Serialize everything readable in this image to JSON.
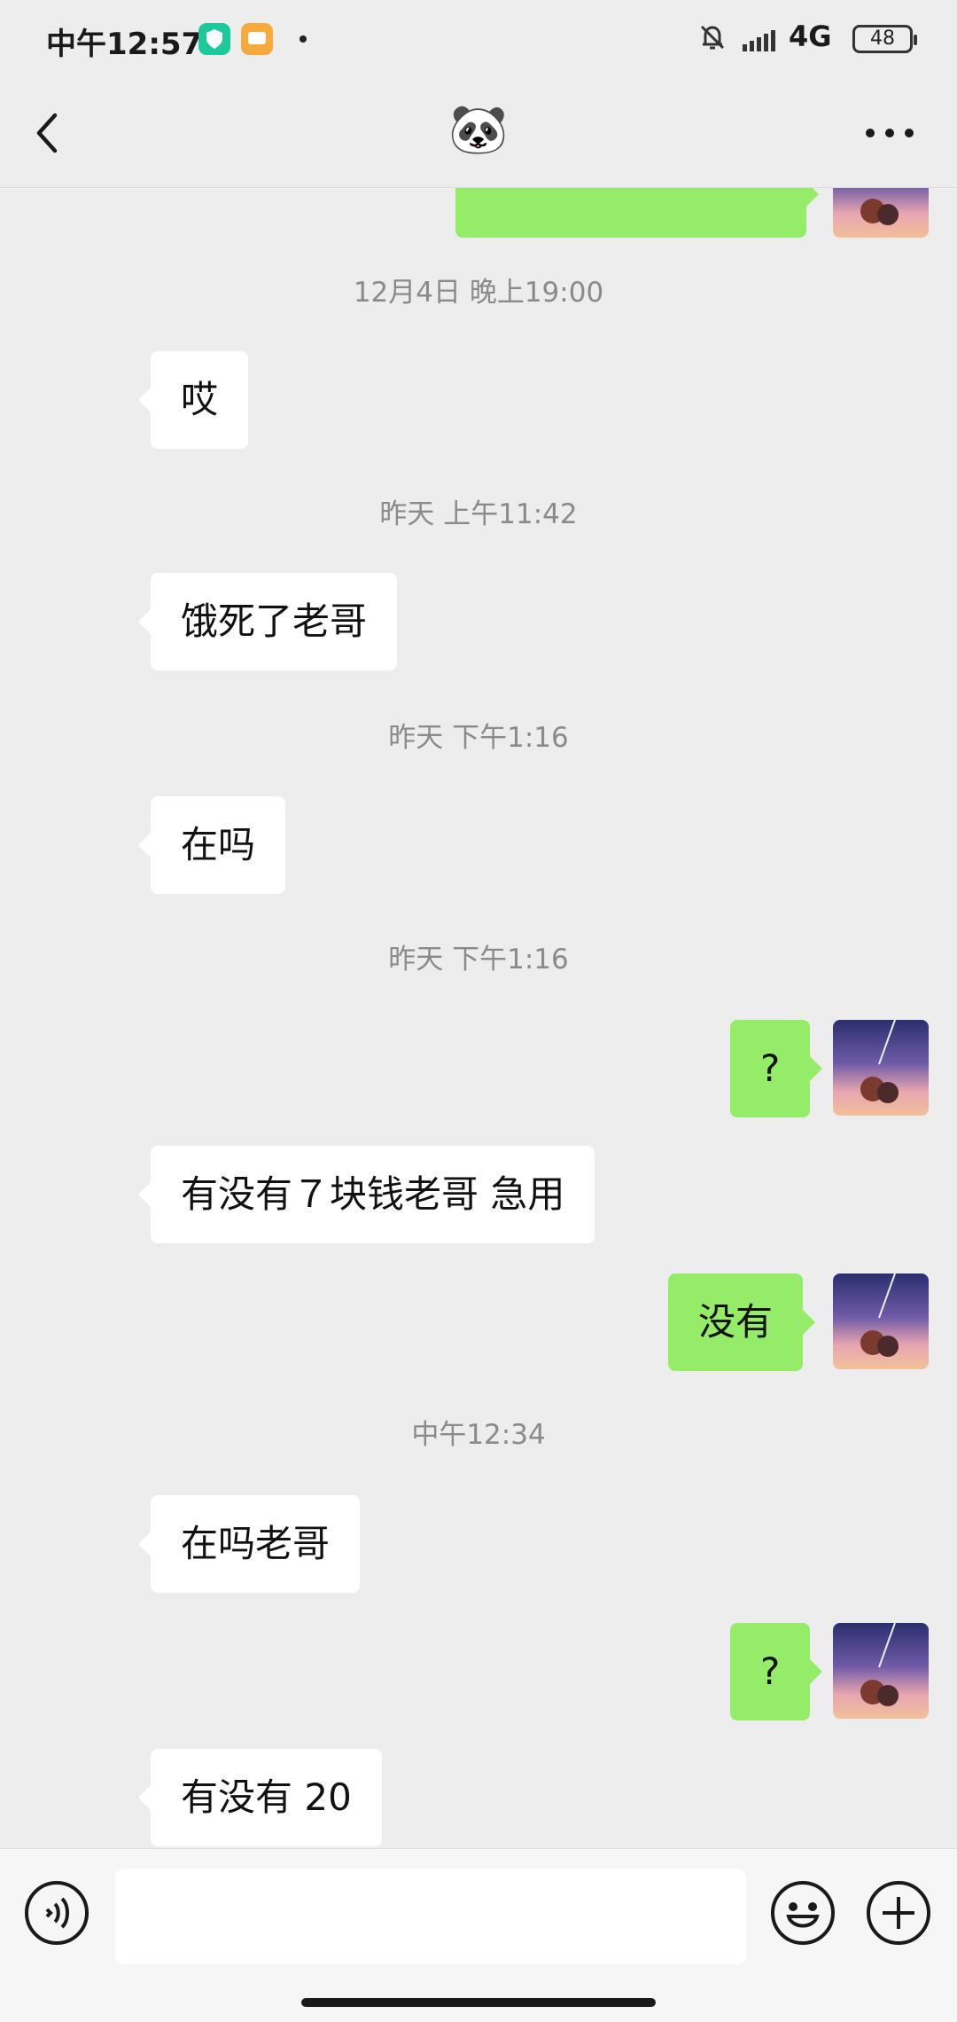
{
  "status_bar": {
    "time": "中午12:57",
    "network": "4G",
    "battery": "48"
  },
  "nav": {
    "title": "🐼"
  },
  "messages": {
    "ts_1": "12月4日 晚上19:00",
    "msg_1": "哎",
    "ts_2": "昨天 上午11:42",
    "msg_2": "饿死了老哥",
    "ts_3": "昨天 下午1:16",
    "msg_3": "在吗",
    "ts_4": "昨天 下午1:16",
    "msg_4": "?",
    "msg_5": "有没有７块钱老哥  急用",
    "msg_6": "没有",
    "ts_5": "中午12:34",
    "msg_7": "在吗老哥",
    "msg_8": "?",
    "msg_9": "有没有 20"
  },
  "input": {
    "placeholder": ""
  },
  "colors": {
    "background": "#ededed",
    "outgoing_bubble": "#95ec69",
    "incoming_bubble": "#ffffff",
    "timestamp_text": "#8a8a8a"
  },
  "icons": [
    "back-arrow-icon",
    "more-icon",
    "voice-icon",
    "emoji-icon",
    "plus-icon",
    "avatar-image"
  ]
}
